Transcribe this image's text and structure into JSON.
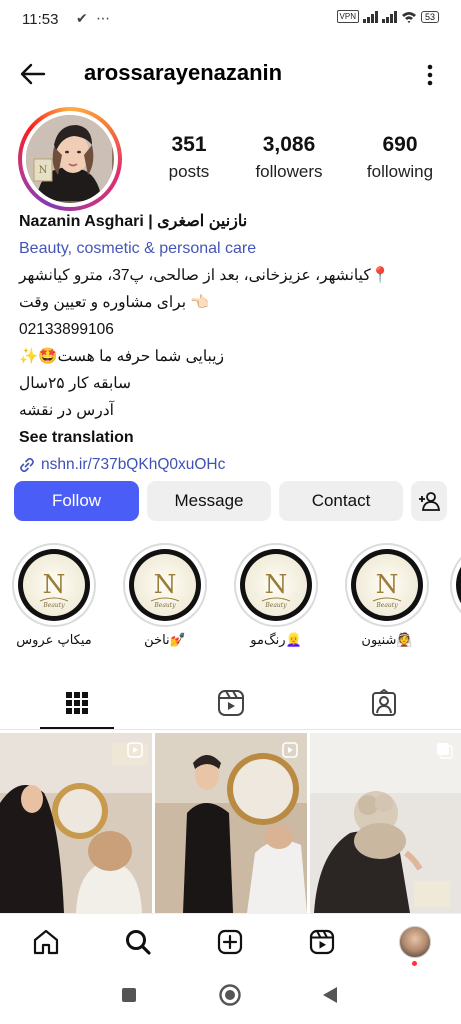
{
  "status_bar": {
    "time": "11:53",
    "left_icons": "✔ ⋯",
    "vpn": "VPN",
    "battery": "53"
  },
  "header": {
    "username": "arossarayenazanin"
  },
  "stats": [
    {
      "value": "351",
      "label": "posts"
    },
    {
      "value": "3,086",
      "label": "followers"
    },
    {
      "value": "690",
      "label": "following"
    }
  ],
  "bio": {
    "name": "Nazanin Asghari | نازنین اصغری",
    "category": "Beauty, cosmetic & personal care",
    "lines": [
      "کیانشهر، عزیزخانی، بعد از صالحی، پ37، مترو کیانشهر📍",
      "برای مشاوره و تعیین وقت 👈🏻",
      "02133899106",
      "✨🤩زیبایی شما حرفه ما هست",
      "سابقه کار ۲۵سال",
      "آدرس در نقشه"
    ],
    "see_translation": "See translation",
    "link": "nshn.ir/737bQKhQ0xuOHc"
  },
  "buttons": {
    "follow": "Follow",
    "message": "Message",
    "contact": "Contact"
  },
  "highlights": [
    {
      "label": "میکاپ عروس"
    },
    {
      "label": "ناخن💅"
    },
    {
      "label": "رنگ‌مو👱‍♀️"
    },
    {
      "label": "شنیون👰"
    }
  ],
  "colors": {
    "follow_button": "#4a5df7",
    "link": "#3f51b5",
    "category": "#4355b9",
    "notification_dot": "#ff3040"
  },
  "icons": [
    "back-arrow-icon",
    "more-vertical-icon",
    "add-person-icon",
    "grid-icon",
    "reels-icon",
    "tagged-icon",
    "home-icon",
    "search-icon",
    "create-icon",
    "reels-nav-icon",
    "profile-avatar"
  ]
}
